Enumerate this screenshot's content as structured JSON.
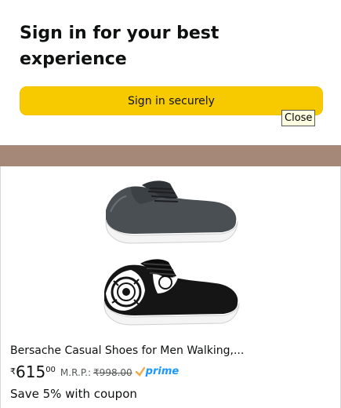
{
  "signin": {
    "title": "Sign in for your best experience",
    "button_label": "Sign in securely",
    "close_tooltip": "Close"
  },
  "product": {
    "image_icon": "shoe-pair-image",
    "title": "Bersache Casual Shoes for Men Walking,...",
    "price_symbol": "₹",
    "price_whole": "615",
    "price_fraction": "00",
    "mrp_label": "M.R.P.:",
    "mrp_value": "₹998.00",
    "prime_label": "prime",
    "coupon": "Save 5% with coupon"
  },
  "colors": {
    "signin_button": "#f7ca00",
    "divider_band": "#a58877",
    "prime_blue": "#1a98ff"
  }
}
